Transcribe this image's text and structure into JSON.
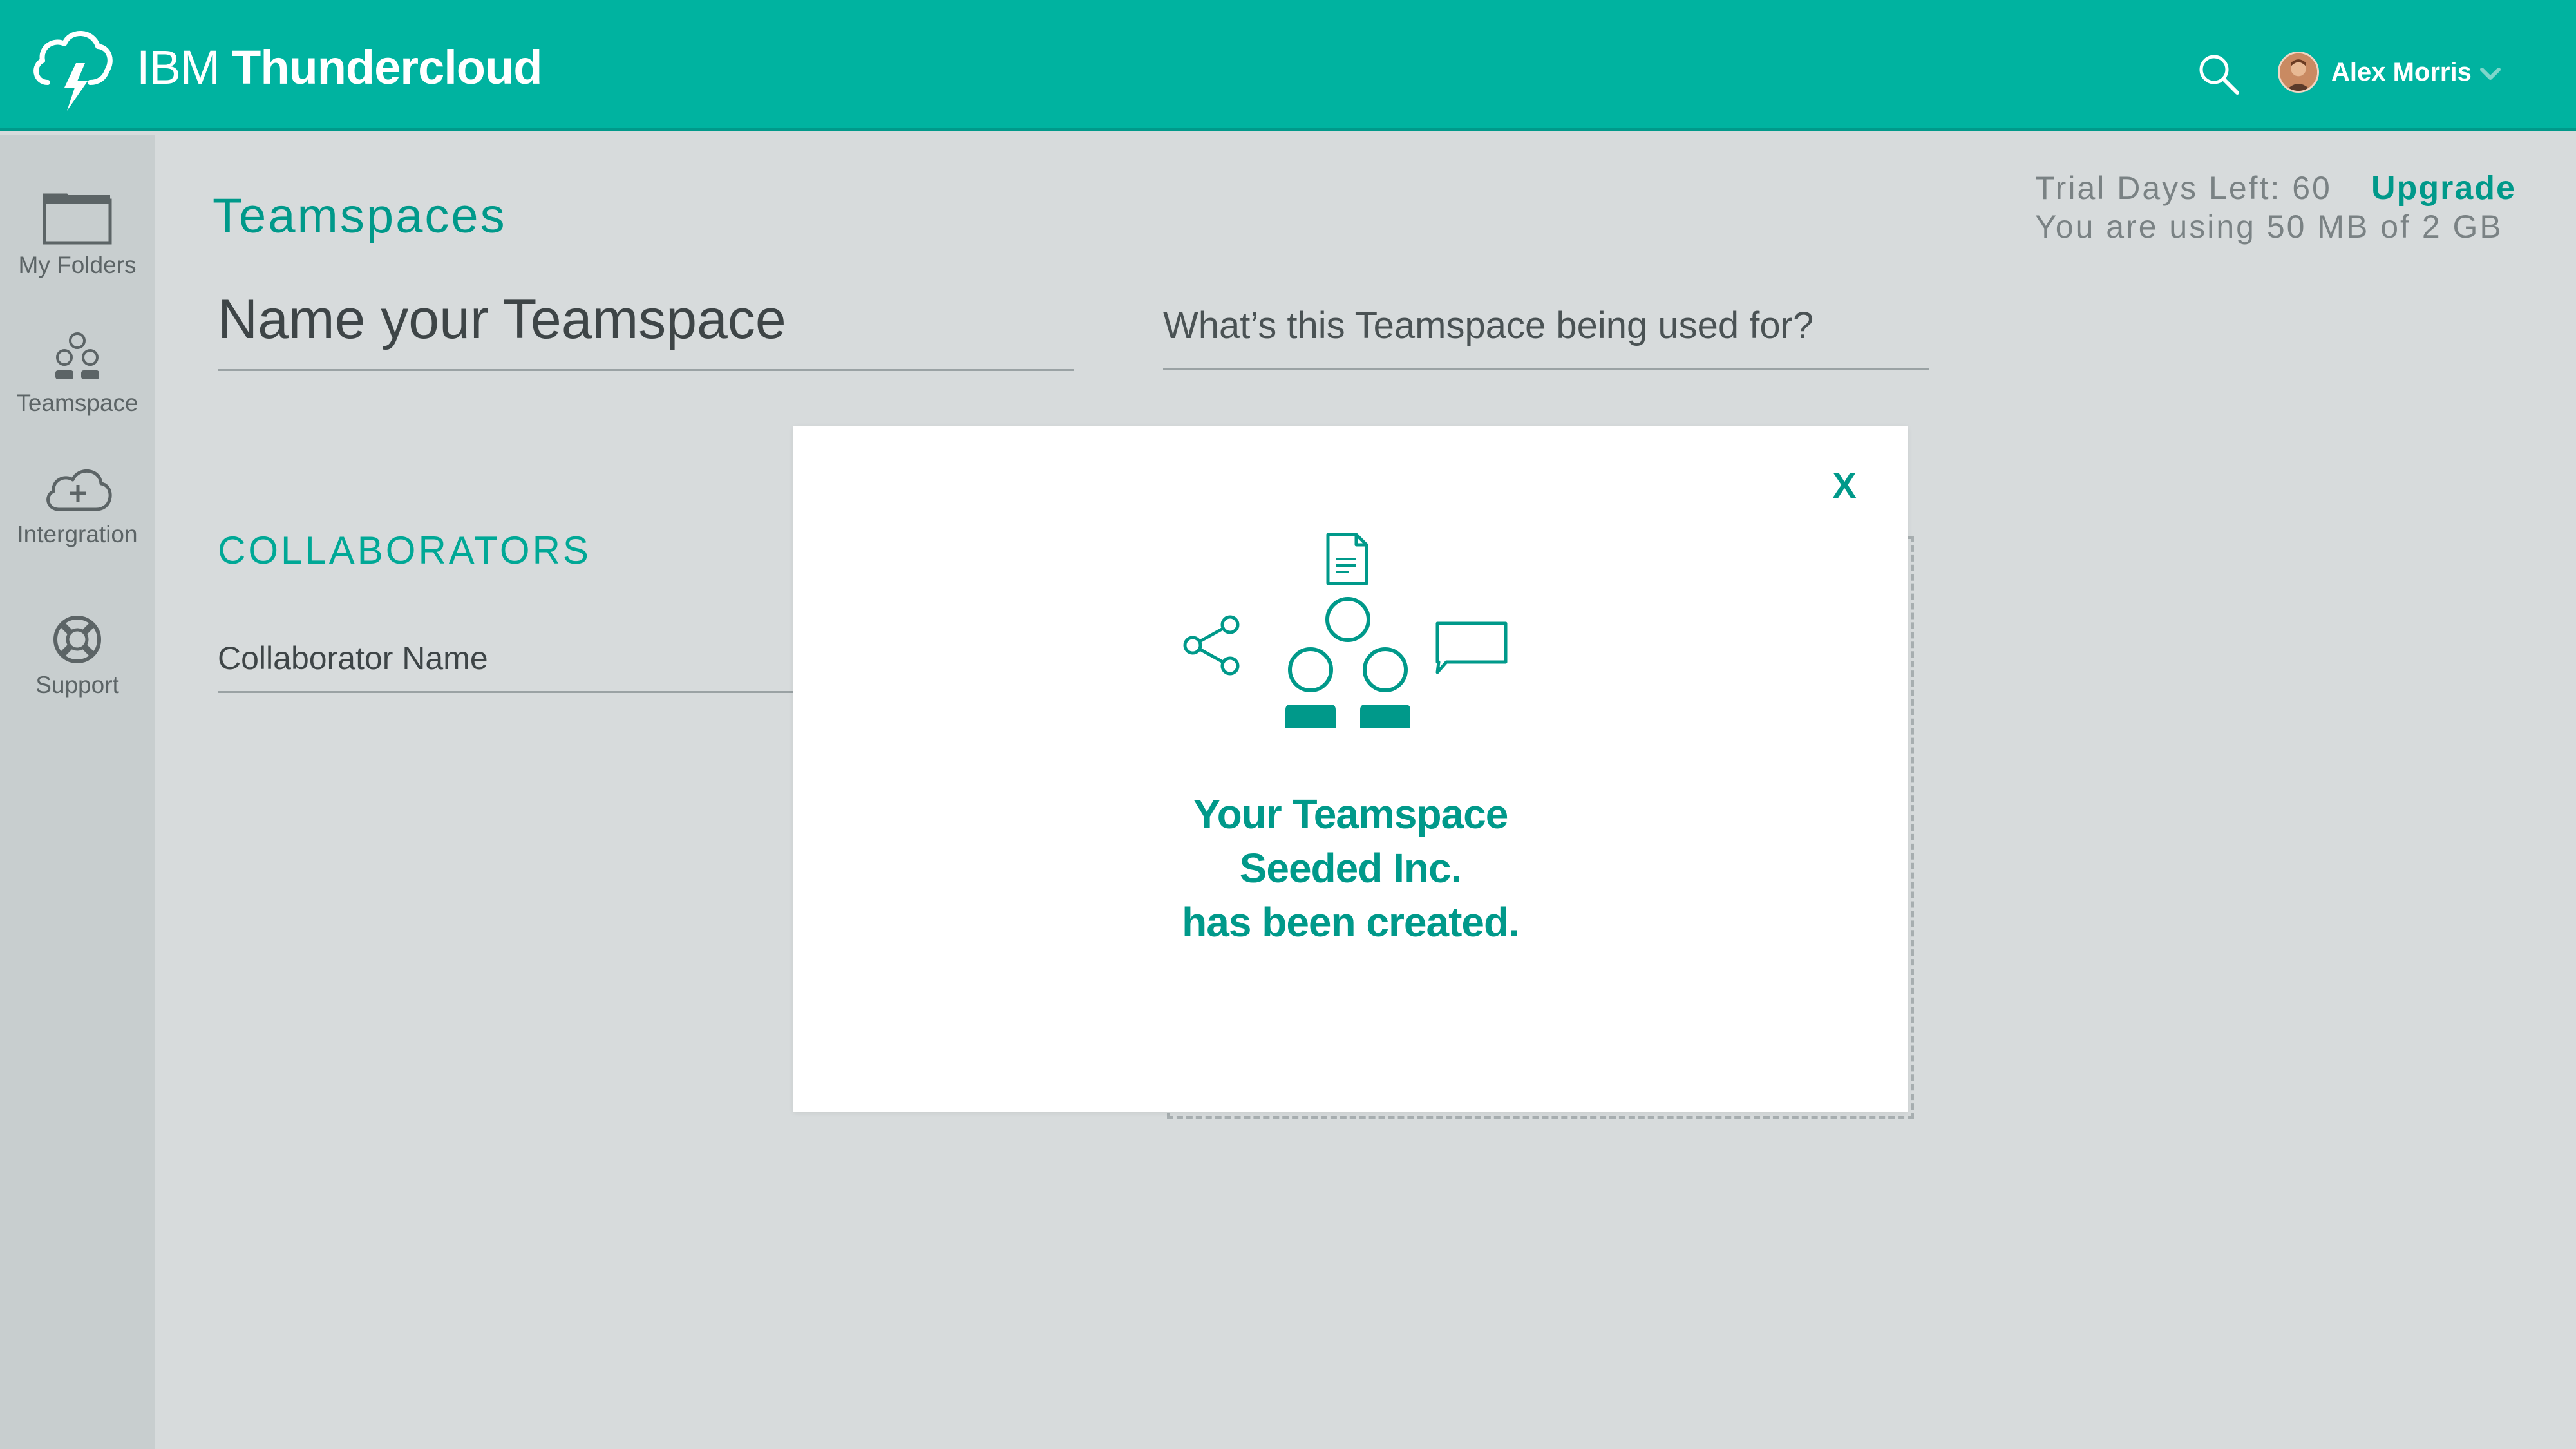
{
  "header": {
    "brand_light": "IBM",
    "brand_bold": "Thundercloud",
    "user_name": "Alex Morris",
    "icons": [
      "cloud-lightning-icon",
      "search-icon",
      "avatar",
      "chevron-down-icon"
    ]
  },
  "sidebar": {
    "items": [
      {
        "label": "My Folders",
        "icon": "folder-icon"
      },
      {
        "label": "Teamspace",
        "icon": "team-icon"
      },
      {
        "label": "Intergration",
        "icon": "cloud-add-icon"
      },
      {
        "label": "Support",
        "icon": "lifebuoy-icon"
      }
    ]
  },
  "main": {
    "title": "Teamspaces",
    "trial_text": "Trial Days Left: 60",
    "upgrade_label": "Upgrade",
    "storage_text": "You are using 50 MB of 2 GB",
    "name_placeholder": "Name your Teamspace",
    "purpose_placeholder": "What’s this Teamspace being used for?",
    "collaborators_heading": "COLLABORATORS",
    "collaborator_placeholder": "Collaborator Name"
  },
  "modal": {
    "close_label": "X",
    "message_lines": [
      "Your Teamspace",
      "Seeded Inc.",
      "has been created."
    ],
    "icons": [
      "document-icon",
      "share-icon",
      "team-icon",
      "chat-bubble-icon"
    ]
  },
  "colors": {
    "header": "#00b3a0",
    "accent": "#00998a",
    "sidebar": "#c8cecf",
    "background": "#d7dbdc",
    "modal": "#ffffff"
  }
}
